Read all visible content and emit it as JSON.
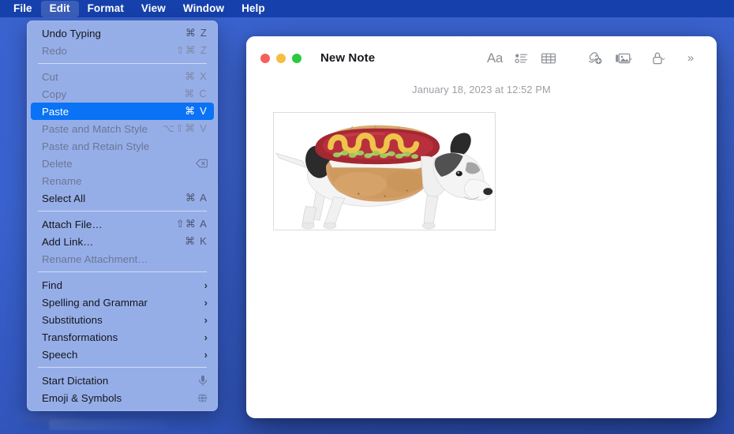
{
  "menubar": {
    "items": [
      {
        "label": "File",
        "active": false
      },
      {
        "label": "Edit",
        "active": true
      },
      {
        "label": "Format",
        "active": false
      },
      {
        "label": "View",
        "active": false
      },
      {
        "label": "Window",
        "active": false
      },
      {
        "label": "Help",
        "active": false
      }
    ]
  },
  "edit_menu": {
    "groups": [
      [
        {
          "label": "Undo Typing",
          "shortcut": "⌘ Z",
          "state": "enabled"
        },
        {
          "label": "Redo",
          "shortcut": "⇧⌘ Z",
          "state": "disabled"
        }
      ],
      [
        {
          "label": "Cut",
          "shortcut": "⌘ X",
          "state": "disabled"
        },
        {
          "label": "Copy",
          "shortcut": "⌘ C",
          "state": "disabled"
        },
        {
          "label": "Paste",
          "shortcut": "⌘ V",
          "state": "selected"
        },
        {
          "label": "Paste and Match Style",
          "shortcut": "⌥⇧⌘ V",
          "state": "disabled"
        },
        {
          "label": "Paste and Retain Style",
          "shortcut": "",
          "state": "disabled"
        },
        {
          "label": "Delete",
          "shortcut": "",
          "state": "disabled",
          "icon": "delete-backward-icon"
        },
        {
          "label": "Rename",
          "shortcut": "",
          "state": "disabled"
        },
        {
          "label": "Select All",
          "shortcut": "⌘ A",
          "state": "enabled"
        }
      ],
      [
        {
          "label": "Attach File…",
          "shortcut": "⇧⌘ A",
          "state": "enabled"
        },
        {
          "label": "Add Link…",
          "shortcut": "⌘ K",
          "state": "enabled"
        },
        {
          "label": "Rename Attachment…",
          "shortcut": "",
          "state": "disabled"
        }
      ],
      [
        {
          "label": "Find",
          "shortcut": "",
          "state": "enabled",
          "submenu": true
        },
        {
          "label": "Spelling and Grammar",
          "shortcut": "",
          "state": "enabled",
          "submenu": true
        },
        {
          "label": "Substitutions",
          "shortcut": "",
          "state": "enabled",
          "submenu": true
        },
        {
          "label": "Transformations",
          "shortcut": "",
          "state": "enabled",
          "submenu": true
        },
        {
          "label": "Speech",
          "shortcut": "",
          "state": "enabled",
          "submenu": true
        }
      ],
      [
        {
          "label": "Start Dictation",
          "shortcut": "",
          "state": "enabled",
          "icon": "microphone-icon"
        },
        {
          "label": "Emoji & Symbols",
          "shortcut": "",
          "state": "enabled",
          "icon": "emoji-globe-icon"
        }
      ]
    ],
    "highlight_color": "#0A72F5",
    "background_color": "#96AEE8"
  },
  "notes_window": {
    "title": "New Note",
    "traffic_lights": [
      {
        "name": "close",
        "color": "#F6605A"
      },
      {
        "name": "minimize",
        "color": "#F6BD42"
      },
      {
        "name": "zoom",
        "color": "#2AC940"
      }
    ],
    "toolbar": [
      {
        "name": "format-text-button",
        "glyph": "Aa"
      },
      {
        "name": "checklist-button",
        "glyph": "checklist-icon"
      },
      {
        "name": "table-button",
        "glyph": "table-icon"
      },
      {
        "name": "add-link-button",
        "glyph": "link-plus-icon"
      },
      {
        "name": "media-button",
        "glyph": "media-photo-icon",
        "caret": "⌄"
      },
      {
        "name": "lock-button",
        "glyph": "lock-icon",
        "caret": "⌄"
      },
      {
        "name": "more-button",
        "glyph": "»"
      }
    ],
    "date": "January 18, 2023 at 12:52 PM",
    "attachment": {
      "name": "dog-in-hotdog-costume-image",
      "alt": "Photo of a dog wearing a hot dog costume"
    }
  },
  "desktop": {
    "wallpaper_top": "#3A63CF",
    "wallpaper_bottom": "#2B4CAE",
    "menubar_color": "#1641AC"
  }
}
